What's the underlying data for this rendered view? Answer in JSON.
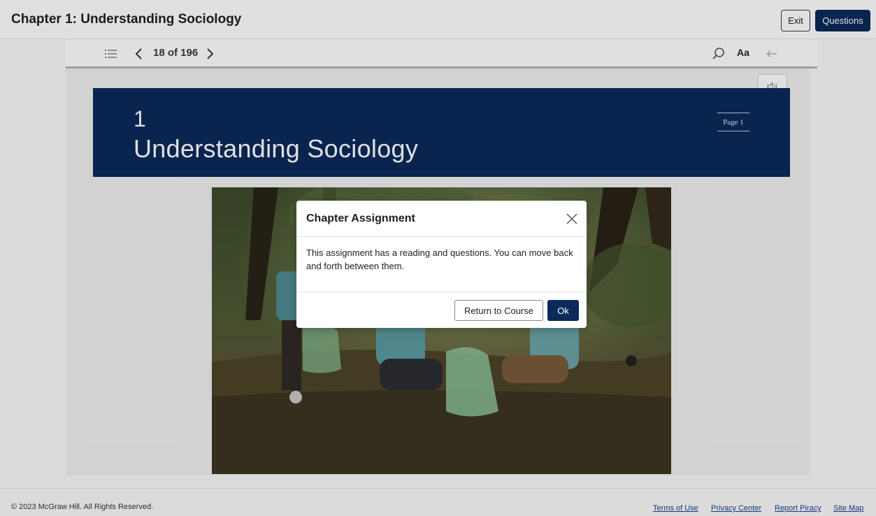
{
  "header": {
    "title": "Chapter 1: Understanding Sociology",
    "exit_label": "Exit",
    "questions_label": "Questions"
  },
  "toolbar": {
    "page_indicator": "18 of 196",
    "font_label": "Aa",
    "icons": [
      "list-icon",
      "chevron-left-icon",
      "chevron-right-icon",
      "search-icon",
      "back-arrow-icon"
    ]
  },
  "content": {
    "chapter_number": "1",
    "chapter_title": "Understanding Sociology",
    "page_marker": "Page 1",
    "audio_icon": "speaker-icon",
    "banner_color": "#0b2a5b"
  },
  "modal": {
    "title": "Chapter Assignment",
    "body": "This assignment has a reading and questions. You can move back and forth between them.",
    "return_label": "Return to Course",
    "ok_label": "Ok"
  },
  "footer": {
    "copyright": "© 2023 McGraw Hill. All Rights Reserved.",
    "links": [
      "Terms of Use",
      "Privacy Center",
      "Report Piracy",
      "Site Map"
    ]
  }
}
